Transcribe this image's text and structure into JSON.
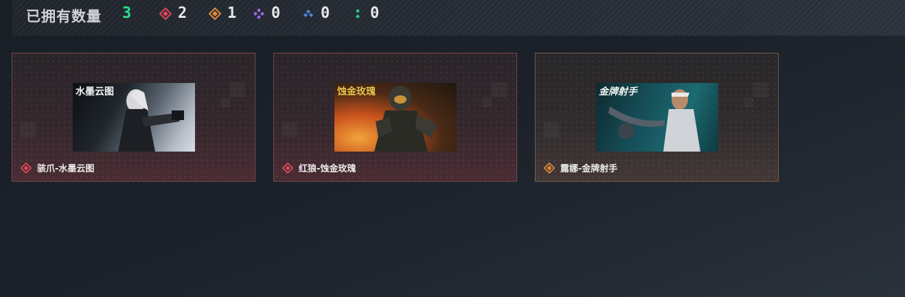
{
  "header": {
    "owned_label": "已拥有数量",
    "owned_count": "3",
    "rarities": [
      {
        "icon": "red-diamond-gem-icon",
        "color": "#e0475a",
        "count": "2"
      },
      {
        "icon": "orange-diamond-gem-icon",
        "color": "#e08a3c",
        "count": "1"
      },
      {
        "icon": "purple-quad-gem-icon",
        "color": "#9a6ae8",
        "count": "0"
      },
      {
        "icon": "blue-triple-gem-icon",
        "color": "#4a8ad8",
        "count": "0"
      },
      {
        "icon": "green-double-gem-icon",
        "color": "#2fc98a",
        "count": "0"
      }
    ]
  },
  "cards": [
    {
      "name": "骇爪-水墨云图",
      "rarity_icon": "red-diamond-gem-icon",
      "rarity_color": "#e0475a",
      "thumb_title": "水墨云图"
    },
    {
      "name": "红狼-蚀金玫瑰",
      "rarity_icon": "red-diamond-gem-icon",
      "rarity_color": "#e0475a",
      "thumb_title": "蚀金玫瑰"
    },
    {
      "name": "露娜-金牌射手",
      "rarity_icon": "orange-diamond-gem-icon",
      "rarity_color": "#e08a3c",
      "thumb_title": "金牌射手"
    }
  ]
}
